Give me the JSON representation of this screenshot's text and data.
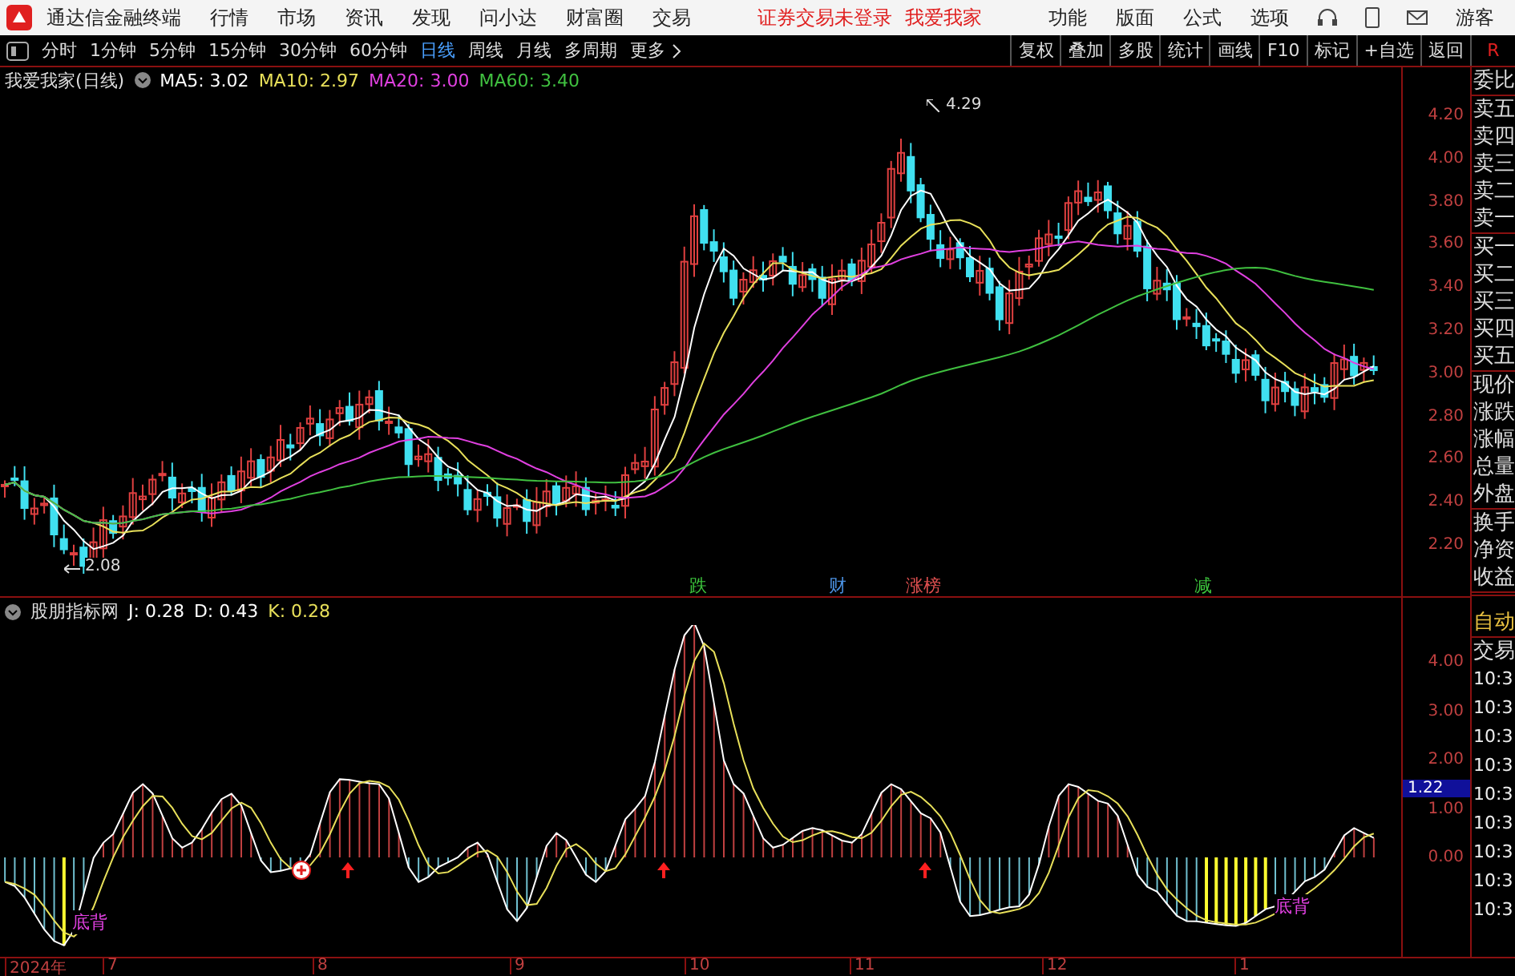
{
  "menu_bar": {
    "app_title": "通达信金融终端",
    "menus": [
      "行情",
      "市场",
      "资讯",
      "发现",
      "问小达",
      "财富圈",
      "交易"
    ],
    "login_status": "证券交易未登录",
    "account": "我爱我家",
    "functions": [
      "功能",
      "版面",
      "公式",
      "选项"
    ],
    "user": "游客"
  },
  "period_bar": {
    "periods": [
      {
        "label": "分时",
        "selected": false
      },
      {
        "label": "1分钟",
        "selected": false
      },
      {
        "label": "5分钟",
        "selected": false
      },
      {
        "label": "15分钟",
        "selected": false
      },
      {
        "label": "30分钟",
        "selected": false
      },
      {
        "label": "60分钟",
        "selected": false
      },
      {
        "label": "日线",
        "selected": true
      },
      {
        "label": "周线",
        "selected": false
      },
      {
        "label": "月线",
        "selected": false
      },
      {
        "label": "多周期",
        "selected": false
      }
    ],
    "more": "更多",
    "tools": [
      "复权",
      "叠加",
      "多股",
      "统计",
      "画线",
      "F10",
      "标记",
      "+自选",
      "返回"
    ],
    "corner": "R"
  },
  "price_chart": {
    "legend": {
      "title": "我爱我家(日线)",
      "mas": [
        {
          "label": "MA5: 3.02",
          "color": "#ffffff"
        },
        {
          "label": "MA10: 2.97",
          "color": "#e8e05a"
        },
        {
          "label": "MA20: 3.00",
          "color": "#e040e0"
        },
        {
          "label": "MA60: 3.40",
          "color": "#40c040"
        }
      ]
    },
    "y_labels": [
      "4.20",
      "4.00",
      "3.80",
      "3.60",
      "3.40",
      "3.20",
      "3.00",
      "2.80",
      "2.60",
      "2.40",
      "2.20"
    ],
    "low_marker": "2.08",
    "high_marker": "4.29",
    "signals": [
      {
        "label": "跌",
        "color": "#3cc43c"
      },
      {
        "label": "财",
        "color": "#4a90e0"
      },
      {
        "label": "涨榜",
        "color": "#e05050"
      },
      {
        "label": "减",
        "color": "#3cc43c"
      }
    ]
  },
  "indicator": {
    "name": "股朋指标网",
    "values": [
      {
        "label": "J: 0.28",
        "color": "#ffffff"
      },
      {
        "label": "D: 0.43",
        "color": "#ffffff"
      },
      {
        "label": "K: 0.28",
        "color": "#e8e05a"
      }
    ],
    "y_labels": [
      "4.00",
      "3.00",
      "2.00",
      "1.00",
      "0.00"
    ],
    "cursor_value": "1.22",
    "divergence_labels": [
      "底背",
      "底背"
    ]
  },
  "x_axis": {
    "labels": [
      "2024年",
      "7",
      "8",
      "9",
      "10",
      "11",
      "12",
      "1"
    ]
  },
  "quote_panel": {
    "groups": [
      [
        "委比"
      ],
      [
        "卖五",
        "卖四",
        "卖三",
        "卖二",
        "卖一"
      ],
      [
        "买一",
        "买二",
        "买三",
        "买四",
        "买五"
      ],
      [
        "现价",
        "涨跌",
        "涨幅",
        "总量",
        "外盘"
      ],
      [
        "换手",
        "净资",
        "收益"
      ]
    ],
    "auto_label": "自动",
    "trade_label": "交易",
    "times": [
      "10:3",
      "10:3",
      "10:3",
      "10:3",
      "10:3",
      "10:3",
      "10:3",
      "10:3",
      "10:3"
    ]
  }
}
